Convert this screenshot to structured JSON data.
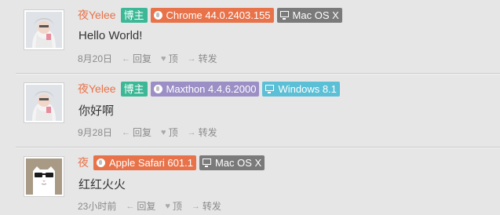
{
  "colors": {
    "author": "#e8734a",
    "badge_owner": "#3cb896",
    "badge_chrome": "#e8734a",
    "badge_maxthon": "#9c8fc6",
    "badge_safari": "#e8734a",
    "badge_mac": "#7a7a7a",
    "badge_windows": "#5bbfd6"
  },
  "comments": [
    {
      "author": "夜Yelee",
      "owner_badge": "博主",
      "browser": "Chrome 44.0.2403.155",
      "os": "Mac OS X",
      "text": "Hello World!",
      "time": "8月20日",
      "reply_label": "回复",
      "like_label": "顶",
      "forward_label": "转发",
      "avatar_icon": "avatar-photo"
    },
    {
      "author": "夜Yelee",
      "owner_badge": "博主",
      "browser": "Maxthon 4.4.6.2000",
      "os": "Windows 8.1",
      "text": "你好啊",
      "time": "9月28日",
      "reply_label": "回复",
      "like_label": "顶",
      "forward_label": "转发",
      "avatar_icon": "avatar-photo"
    },
    {
      "author": "夜",
      "browser": "Apple Safari 601.1",
      "os": "Mac OS X",
      "text": "红红火火",
      "time": "23小时前",
      "reply_label": "回复",
      "like_label": "顶",
      "forward_label": "转发",
      "avatar_icon": "cat-sunglasses-avatar"
    }
  ]
}
